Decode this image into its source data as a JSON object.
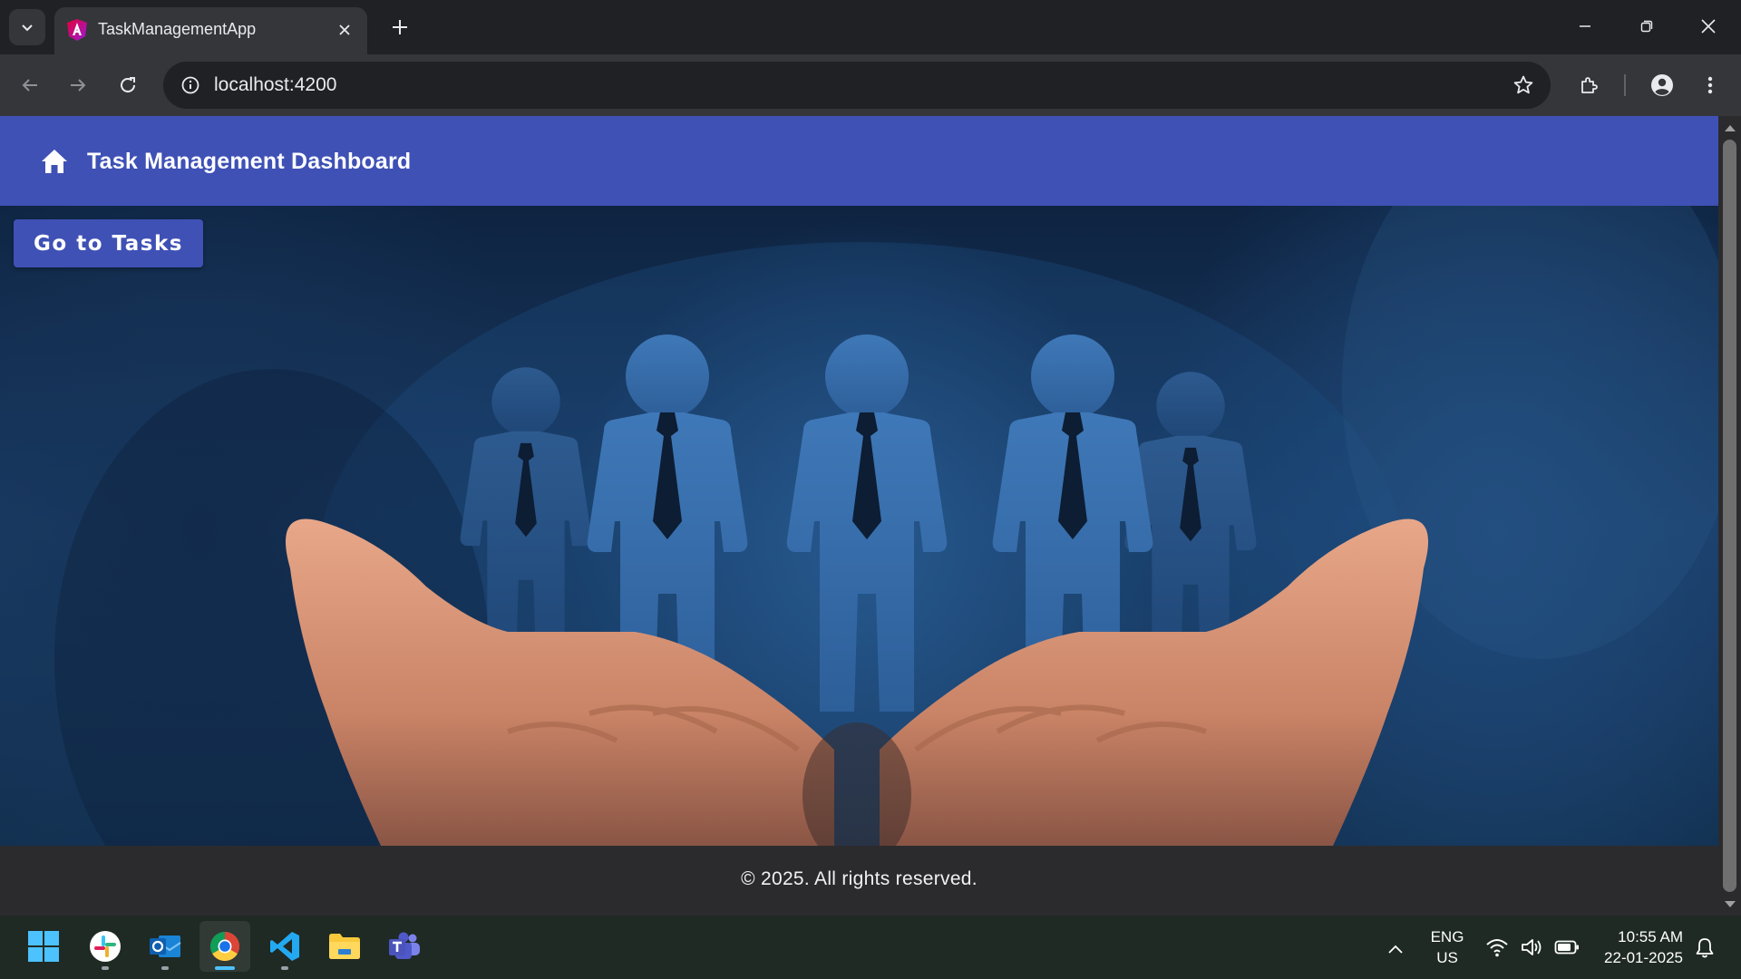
{
  "browser": {
    "tab_title": "TaskManagementApp",
    "url": "localhost:4200"
  },
  "app": {
    "header_title": "Task Management Dashboard",
    "go_tasks_label": "Go to Tasks",
    "footer_text": "© 2025. All rights reserved.",
    "primary_color": "#3f51b5"
  },
  "taskbar": {
    "lang_primary": "ENG",
    "lang_secondary": "US",
    "time": "10:55 AM",
    "date": "22-01-2025",
    "apps": [
      "windows-start",
      "slack",
      "outlook",
      "chrome",
      "vscode",
      "file-explorer",
      "teams"
    ]
  }
}
